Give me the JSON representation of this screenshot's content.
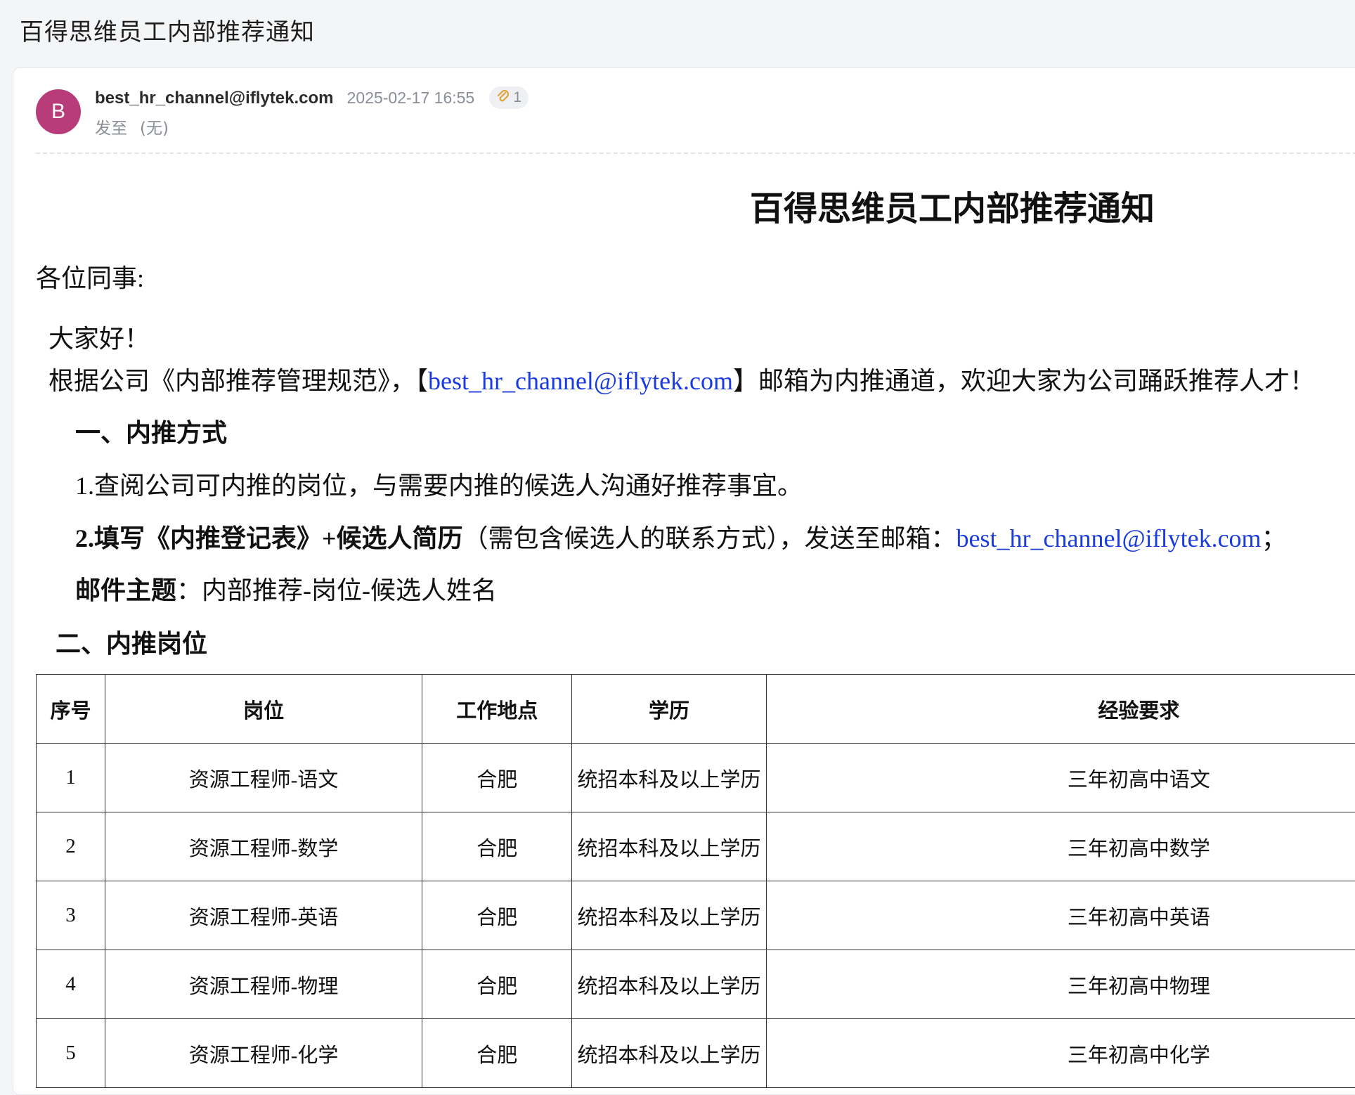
{
  "subject": "百得思维员工内部推荐通知",
  "sender": {
    "avatar_letter": "B",
    "email": "best_hr_channel@iflytek.com",
    "time": "2025-02-17 16:55",
    "attachment_count": "1",
    "recipient_label": "发至",
    "recipient_value": "(无)"
  },
  "colors": {
    "avatar": "#b83c79",
    "link": "#1a3be0"
  },
  "content": {
    "title": "百得思维员工内部推荐通知",
    "greeting": "各位同事:",
    "hello": "大家好！",
    "para1_pre": "根据公司《内部推荐管理规范》，【",
    "para1_link": "best_hr_channel@iflytek.com",
    "para1_post": "】邮箱为内推通道，欢迎大家为公司踊跃推荐人才！",
    "section1": "一、内推方式",
    "step1": "1.查阅公司可内推的岗位，与需要内推的候选人沟通好推荐事宜。",
    "step2_pre": "2.填写《内推登记表》+候选人简历",
    "step2_mid": "（需包含候选人的联系方式），发送至邮箱：",
    "step2_link": "best_hr_channel@iflytek.com",
    "step2_post": "；",
    "subject_label": "邮件主题",
    "subject_value": "：内部推荐-岗位-候选人姓名",
    "section2": "二、内推岗位"
  },
  "table": {
    "headers": [
      "序号",
      "岗位",
      "工作地点",
      "学历",
      "经验要求"
    ],
    "rows": [
      [
        "1",
        "资源工程师-语文",
        "合肥",
        "统招本科及以上学历",
        "三年初高中语文"
      ],
      [
        "2",
        "资源工程师-数学",
        "合肥",
        "统招本科及以上学历",
        "三年初高中数学"
      ],
      [
        "3",
        "资源工程师-英语",
        "合肥",
        "统招本科及以上学历",
        "三年初高中英语"
      ],
      [
        "4",
        "资源工程师-物理",
        "合肥",
        "统招本科及以上学历",
        "三年初高中物理"
      ],
      [
        "5",
        "资源工程师-化学",
        "合肥",
        "统招本科及以上学历",
        "三年初高中化学"
      ]
    ]
  }
}
